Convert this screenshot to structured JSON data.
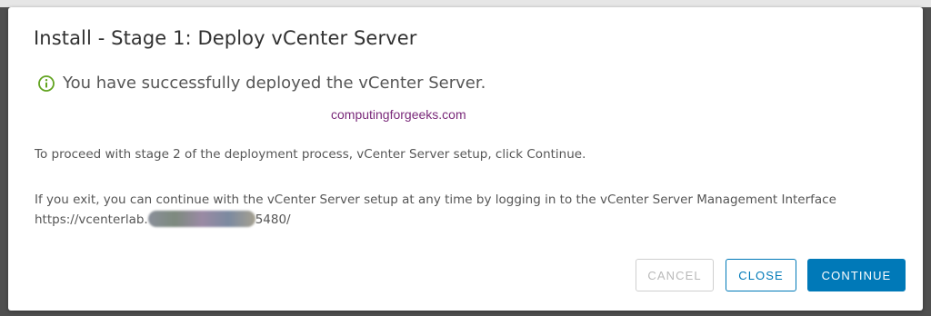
{
  "dialog": {
    "title": "Install - Stage 1: Deploy vCenter Server",
    "success_message": "You have successfully deployed the vCenter Server.",
    "watermark": "computingforgeeks.com",
    "paragraph1": "To proceed with stage 2 of the deployment process, vCenter Server setup, click Continue.",
    "paragraph2": "If you exit, you can continue with the vCenter Server setup at any time by logging in to the vCenter Server Management Interface",
    "url_prefix": "https://vcenterlab.",
    "url_suffix": "5480/"
  },
  "icons": {
    "success": "info-circle-icon",
    "success_color": "#62a420"
  },
  "buttons": {
    "cancel": "CANCEL",
    "close": "CLOSE",
    "continue": "CONTINUE"
  },
  "colors": {
    "primary": "#0079b8",
    "disabled_text": "#b9b9b9"
  }
}
